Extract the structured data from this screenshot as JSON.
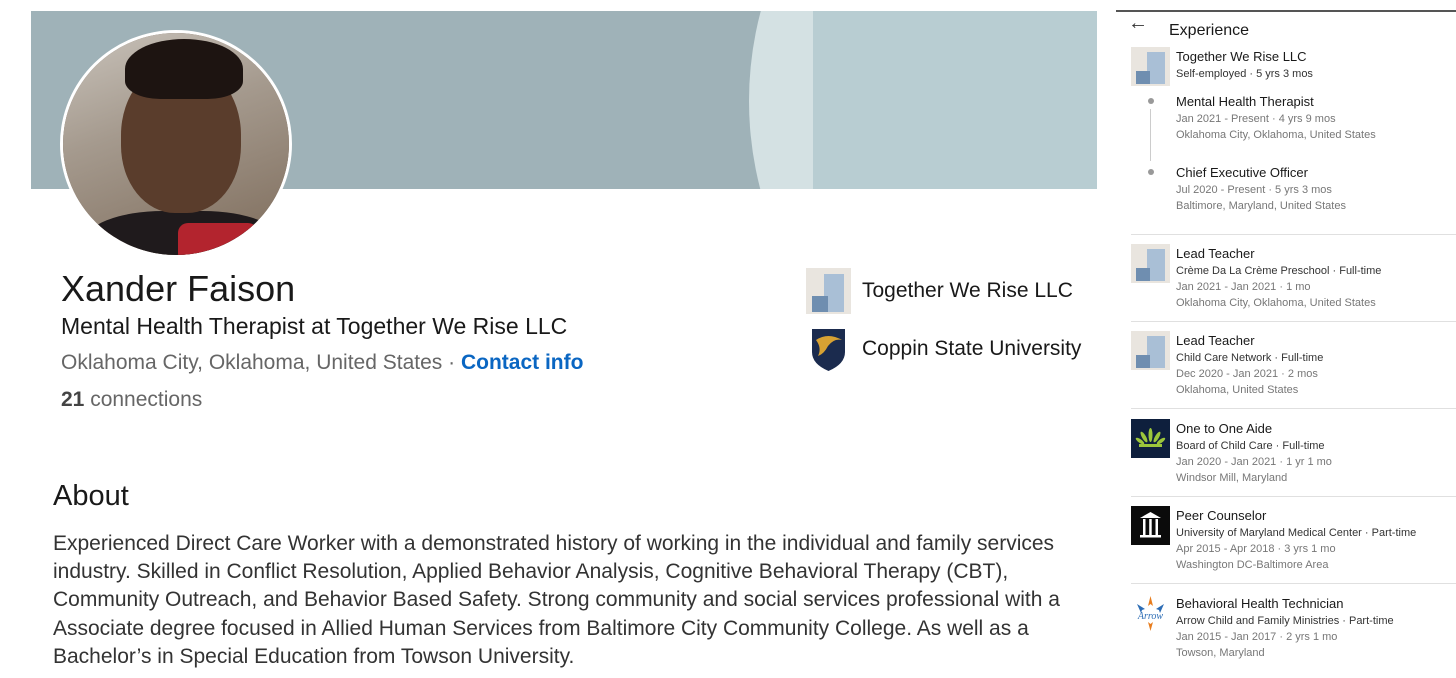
{
  "profile": {
    "name": "Xander Faison",
    "headline": "Mental Health Therapist at Together We Rise LLC",
    "location": "Oklahoma City, Oklahoma, United States",
    "location_sep": " · ",
    "contact_label": "Contact info",
    "connections_count": "21",
    "connections_label": " connections"
  },
  "companies": [
    {
      "name": "Together We Rise LLC",
      "icon": "company-placeholder-icon"
    },
    {
      "name": "Coppin State University",
      "icon": "university-shield-icon"
    }
  ],
  "about": {
    "title": "About",
    "text": "Experienced Direct Care Worker with a demonstrated history of working in the individual and family services industry. Skilled in Conflict Resolution, Applied Behavior Analysis, Cognitive Behavioral Therapy (CBT), Community Outreach, and Behavior Based Safety. Strong community and social services professional with a Associate degree focused in Allied Human Services from Baltimore City Community College. As well as a Bachelor’s in Special Education from Towson University."
  },
  "experience": {
    "title": "Experience",
    "group": {
      "company": "Together We Rise LLC",
      "summary": "Self-employed · 5 yrs 3 mos",
      "roles": [
        {
          "title": "Mental Health Therapist",
          "dates": "Jan 2021 - Present · 4 yrs 9 mos",
          "location": "Oklahoma City, Oklahoma, United States"
        },
        {
          "title": "Chief Executive Officer",
          "dates": "Jul 2020 - Present · 5 yrs 3 mos",
          "location": "Baltimore, Maryland, United States"
        }
      ]
    },
    "items": [
      {
        "title": "Lead Teacher",
        "org": "Crème Da La Crème Preschool · Full-time",
        "dates": "Jan 2021 - Jan 2021 · 1 mo",
        "location": "Oklahoma City, Oklahoma, United States",
        "icon": "company-placeholder-icon"
      },
      {
        "title": "Lead Teacher",
        "org": "Child Care Network · Full-time",
        "dates": "Dec 2020 - Jan 2021 · 2 mos",
        "location": "Oklahoma, United States",
        "icon": "company-placeholder-icon"
      },
      {
        "title": "One to One Aide",
        "org": "Board of Child Care · Full-time",
        "dates": "Jan 2020 - Jan 2021 · 1 yr 1 mo",
        "location": "Windsor Mill, Maryland",
        "icon": "board-of-child-care-logo-icon"
      },
      {
        "title": "Peer Counselor",
        "org": "University of Maryland Medical Center · Part-time",
        "dates": "Apr 2015 - Apr 2018 · 3 yrs 1 mo",
        "location": "Washington DC-Baltimore Area",
        "icon": "umm-logo-icon"
      },
      {
        "title": "Behavioral Health Technician",
        "org": "Arrow Child and Family Ministries · Part-time",
        "dates": "Jan 2015 - Jan 2017 · 2 yrs 1 mo",
        "location": "Towson, Maryland",
        "icon": "arrow-logo-icon"
      }
    ]
  },
  "icons": {
    "back": "←"
  }
}
